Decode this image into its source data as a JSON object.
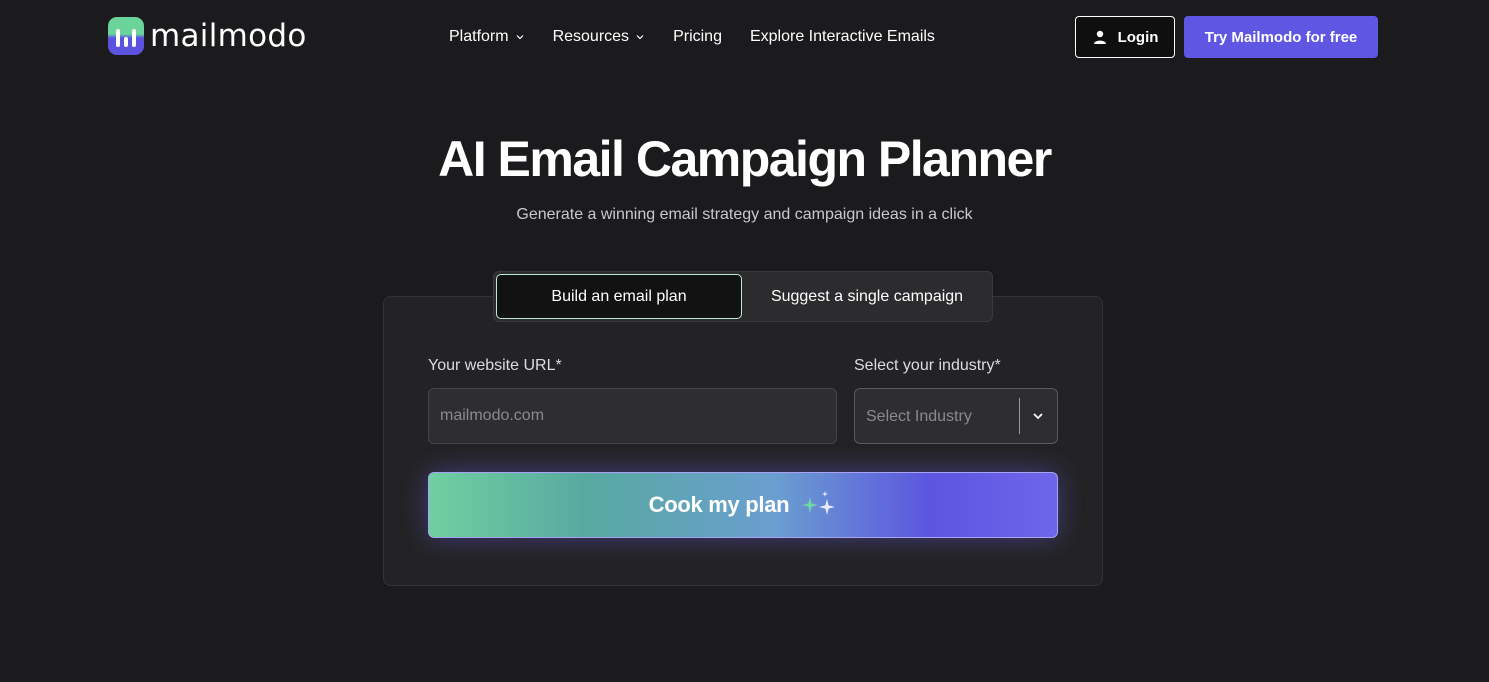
{
  "brand": {
    "name": "mailmodo"
  },
  "nav": {
    "items": [
      {
        "label": "Platform",
        "has_dropdown": true
      },
      {
        "label": "Resources",
        "has_dropdown": true
      },
      {
        "label": "Pricing",
        "has_dropdown": false
      },
      {
        "label": "Explore Interactive Emails",
        "has_dropdown": false
      }
    ],
    "login_label": "Login",
    "cta_label": "Try Mailmodo for free"
  },
  "hero": {
    "title": "AI Email Campaign Planner",
    "subtitle": "Generate a winning email strategy and campaign ideas in a click"
  },
  "tabs": [
    {
      "label": "Build an email plan",
      "active": true
    },
    {
      "label": "Suggest a single campaign",
      "active": false
    }
  ],
  "form": {
    "url_label": "Your website URL*",
    "url_placeholder": "mailmodo.com",
    "url_value": "",
    "industry_label": "Select your industry*",
    "industry_selected": "Select Industry",
    "submit_label": "Cook my plan"
  },
  "colors": {
    "background": "#1b1b1d",
    "card": "#232325",
    "accent_purple": "#5f57e3",
    "accent_green": "#6fd0a0"
  },
  "icons": [
    "user-icon",
    "chevron-down-icon",
    "sparkle-icon"
  ]
}
